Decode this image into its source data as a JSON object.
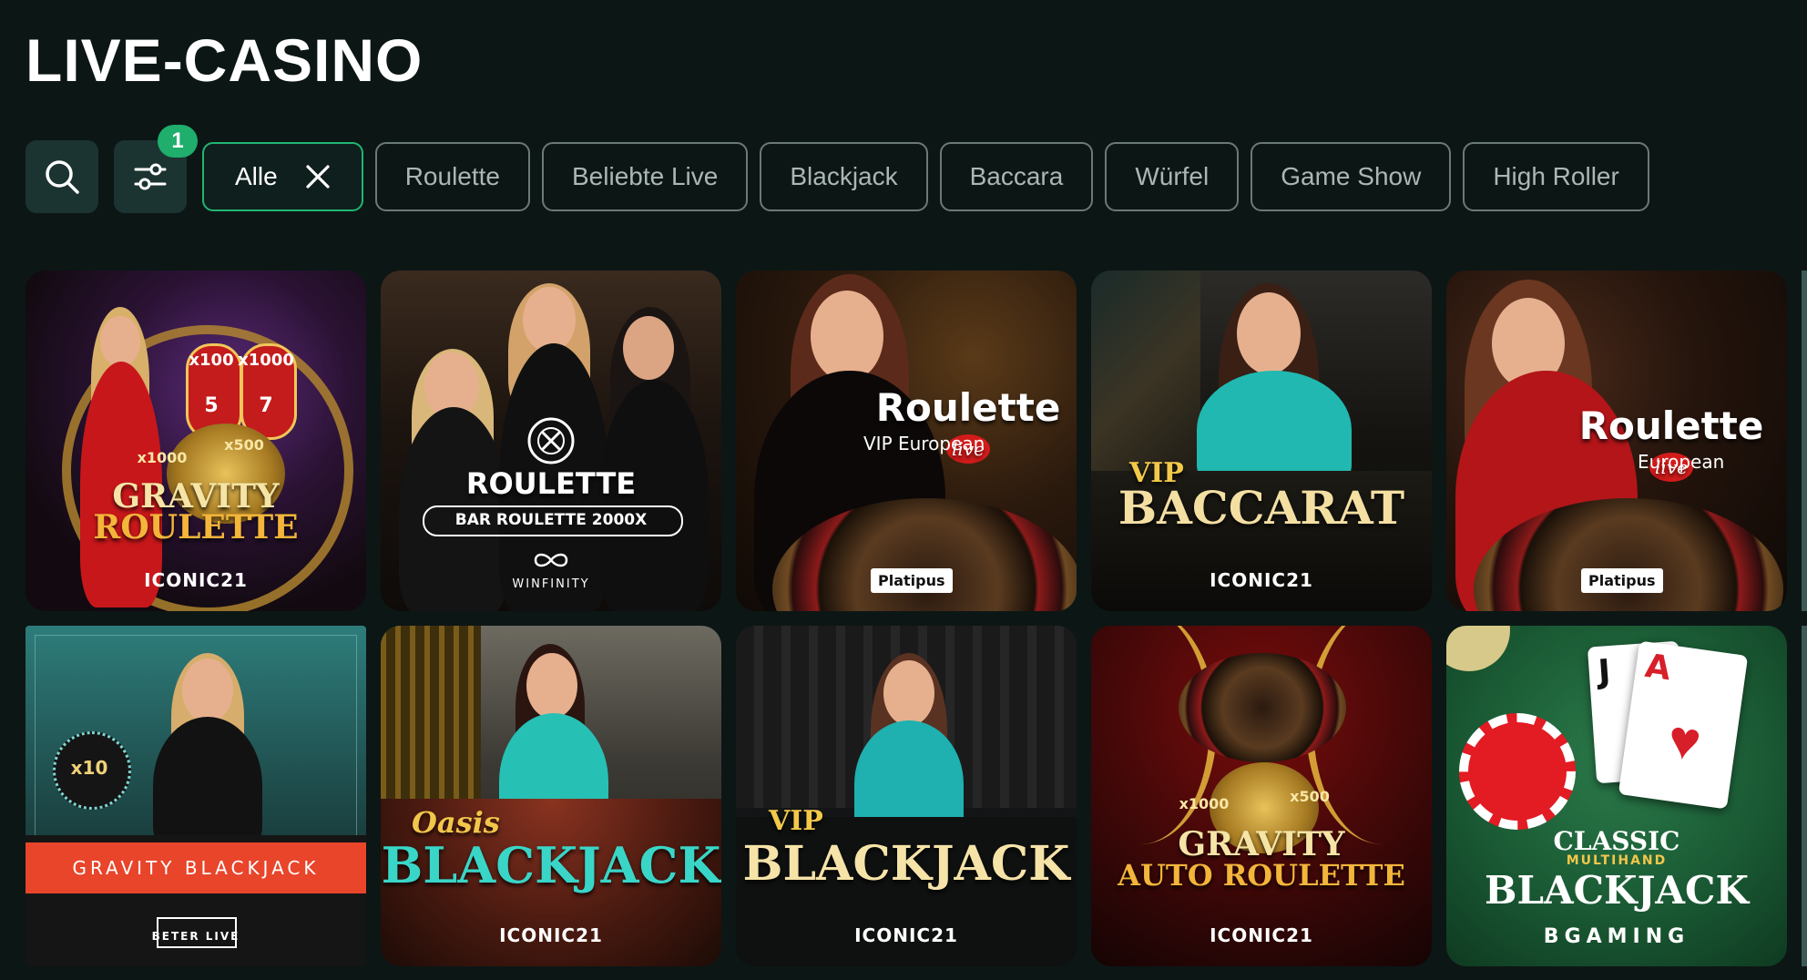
{
  "page": {
    "title": "LIVE-CASINO"
  },
  "toolbar": {
    "search_icon": "search-icon",
    "filter_icon": "sliders-icon",
    "filter_badge": "1"
  },
  "chips": [
    {
      "label": "Alle",
      "active": true
    },
    {
      "label": "Roulette",
      "active": false
    },
    {
      "label": "Beliebte Live",
      "active": false
    },
    {
      "label": "Blackjack",
      "active": false
    },
    {
      "label": "Baccara",
      "active": false
    },
    {
      "label": "Würfel",
      "active": false
    },
    {
      "label": "Game Show",
      "active": false
    },
    {
      "label": "High Roller",
      "active": false
    }
  ],
  "games": [
    {
      "title": "GRAVITY ROULETTE",
      "line1": "GRAVITY",
      "line2": "ROULETTE",
      "provider": "ICONIC21",
      "multipliers": [
        "x100",
        "x1000",
        "5",
        "7",
        "x1000",
        "x500"
      ]
    },
    {
      "title": "ROULETTE",
      "subtitle": "BAR ROULETTE 2000X",
      "provider": "WINFINITY"
    },
    {
      "title": "Roulette",
      "badge": "live",
      "subtitle": "VIP European",
      "provider": "Platipus"
    },
    {
      "title": "BACCARAT",
      "prefix": "VIP",
      "provider": "ICONIC21"
    },
    {
      "title": "Roulette",
      "badge": "live",
      "subtitle": "European",
      "provider": "Platipus"
    },
    {
      "title": "GRAVITY BLACKJACK",
      "multiplier": "x10",
      "provider": "BETER LIVE"
    },
    {
      "title": "BLACKJACK",
      "prefix": "Oasis",
      "provider": "ICONIC21"
    },
    {
      "title": "BLACKJACK",
      "prefix": "VIP",
      "provider": "ICONIC21"
    },
    {
      "title": "GRAVITY AUTO ROULETTE",
      "line1": "GRAVITY",
      "line2": "AUTO ROULETTE",
      "provider": "ICONIC21",
      "multipliers": [
        "x1000",
        "x500"
      ]
    },
    {
      "title": "BLACKJACK",
      "prefix": "CLASSIC",
      "sub": "MULTIHAND",
      "provider": "BGAMING",
      "cards": [
        "J",
        "A"
      ]
    }
  ],
  "colors": {
    "background": "#0c1615",
    "accent": "#22b573",
    "chip_border": "#6b7a78",
    "icon_button": "#1c3431"
  }
}
